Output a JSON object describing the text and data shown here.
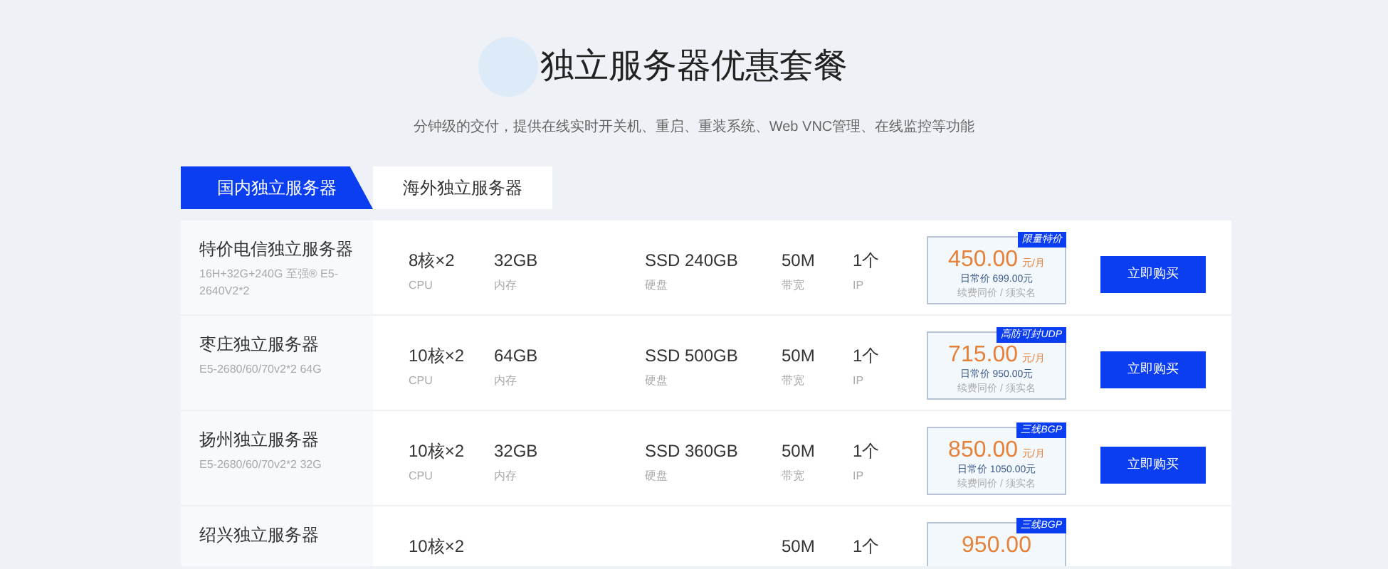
{
  "header": {
    "title": "独立服务器优惠套餐",
    "subtitle": "分钟级的交付，提供在线实时开关机、重启、重装系统、Web VNC管理、在线监控等功能"
  },
  "tabs": [
    {
      "label": "国内独立服务器",
      "selected": true
    },
    {
      "label": "海外独立服务器",
      "selected": false
    }
  ],
  "plans": [
    {
      "name": "特价电信独立服务器",
      "desc": "16H+32G+240G 至强® E5-2640V2*2",
      "specs": [
        {
          "value": "8核×2",
          "label": "CPU"
        },
        {
          "value": "32GB",
          "label": "内存"
        },
        {
          "value": "SSD 240GB",
          "label": "硬盘"
        },
        {
          "value": "50M",
          "label": "带宽"
        },
        {
          "value": "1个",
          "label": "IP"
        }
      ],
      "badge": "限量特价",
      "price": "450.00",
      "unit": "元/月",
      "regular": "日常价 699.00元",
      "note": "续费同价 / 须实名",
      "button": "立即购买"
    },
    {
      "name": "枣庄独立服务器",
      "desc": "E5-2680/60/70v2*2 64G",
      "specs": [
        {
          "value": "10核×2",
          "label": "CPU"
        },
        {
          "value": "64GB",
          "label": "内存"
        },
        {
          "value": "SSD 500GB",
          "label": "硬盘"
        },
        {
          "value": "50M",
          "label": "带宽"
        },
        {
          "value": "1个",
          "label": "IP"
        }
      ],
      "badge": "高防可封UDP",
      "price": "715.00",
      "unit": "元/月",
      "regular": "日常价 950.00元",
      "note": "续费同价 / 须实名",
      "button": "立即购买"
    },
    {
      "name": "扬州独立服务器",
      "desc": "E5-2680/60/70v2*2 32G",
      "specs": [
        {
          "value": "10核×2",
          "label": "CPU"
        },
        {
          "value": "32GB",
          "label": "内存"
        },
        {
          "value": "SSD 360GB",
          "label": "硬盘"
        },
        {
          "value": "50M",
          "label": "带宽"
        },
        {
          "value": "1个",
          "label": "IP"
        }
      ],
      "badge": "三线BGP",
      "price": "850.00",
      "unit": "元/月",
      "regular": "日常价 1050.00元",
      "note": "续费同价 / 须实名",
      "button": "立即购买"
    },
    {
      "name": "绍兴独立服务器",
      "specs": [
        {
          "kind": "cpu",
          "value": "10核×2"
        },
        {
          "kind": "bandwidth",
          "value": "50M"
        },
        {
          "kind": "ip",
          "value": "1个"
        }
      ],
      "badge": "三线BGP",
      "price": "950.00"
    }
  ]
}
